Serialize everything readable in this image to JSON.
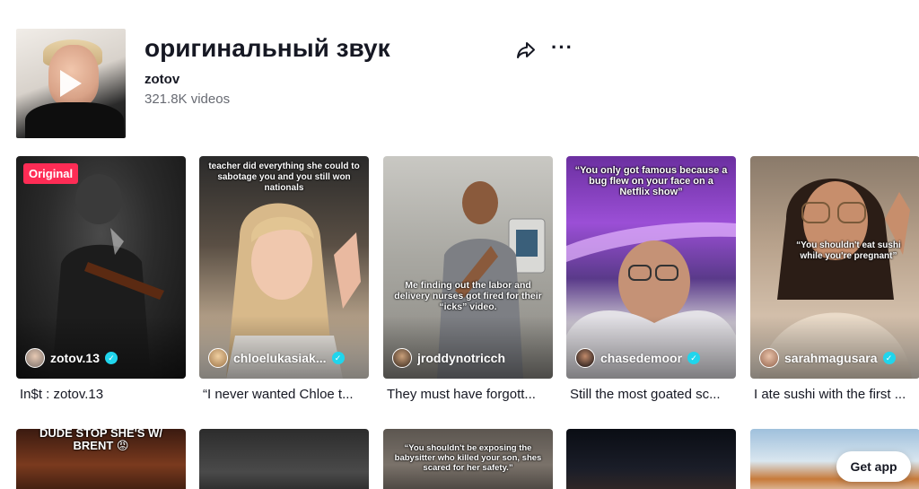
{
  "sound": {
    "title": "оригинальный звук",
    "author": "zotov",
    "videos_count": "321.8K videos"
  },
  "icons": {
    "share": "share-arrow-icon",
    "more": "more-dots-icon",
    "play": "play-icon",
    "verified": "verified-check-icon"
  },
  "colors": {
    "badge": "#fe2c55",
    "verified": "#20d5ec",
    "muted_text": "#676a72"
  },
  "videos": [
    {
      "badge": "Original",
      "username": "zotov.13",
      "verified": true,
      "caption": "",
      "description": "In$t : zotov.13"
    },
    {
      "badge": "",
      "username": "chloelukasiak...",
      "verified": true,
      "caption": "teacher did everything she could to sabotage you and you still won nationals",
      "description": "“I never wanted Chloe t..."
    },
    {
      "badge": "",
      "username": "jroddynotricch",
      "verified": false,
      "caption": "Me finding out the labor and delivery nurses got fired for their “icks” video.",
      "description": "They must have forgott..."
    },
    {
      "badge": "",
      "username": "chasedemoor",
      "verified": true,
      "caption": "“You only got famous because a bug flew on your face on a Netflix show”",
      "description": "Still the most goated sc..."
    },
    {
      "badge": "",
      "username": "sarahmagusara",
      "verified": true,
      "caption": "“You shouldn't eat sushi while you're pregnant”",
      "description": "I ate sushi with the first ..."
    }
  ],
  "row2_captions": [
    "DUDE STOP SHE'S W/ BRENT 😡",
    "",
    "“You shouldn't be exposing the babysitter who killed your son, shes scared for her safety.”",
    "",
    ""
  ],
  "get_app": "Get app"
}
